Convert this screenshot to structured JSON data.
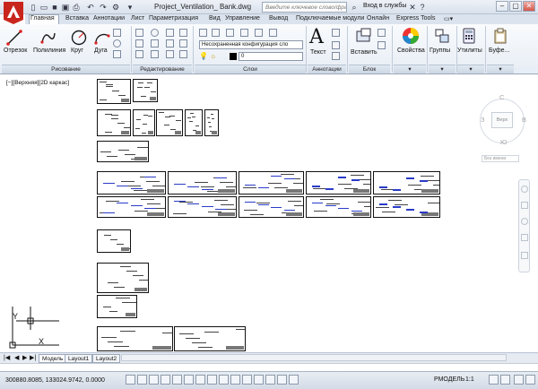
{
  "titlebar": {
    "file_title": "Project_Ventilation_ Bank.dwg",
    "search_placeholder": "Введите ключевое слово/фразу",
    "login": "Вход в службы",
    "help": "?"
  },
  "tabs": [
    "Главная",
    "Вставка",
    "Аннотации",
    "Лист",
    "Параметризация",
    "Вид",
    "Управление",
    "Вывод",
    "Подключаемые модули",
    "Онлайн",
    "Express Tools"
  ],
  "ribbon": {
    "draw_tools": [
      "Отрезок",
      "Полилиния",
      "Круг",
      "Дуга"
    ],
    "draw_group": "Рисование",
    "modify_group": "Редактирование",
    "layer_combo": "Несохраненная конфигурация сло",
    "layer_value": "0",
    "layers_group": "Слои",
    "text_button": "Текст",
    "annotations_group": "Аннотации",
    "insert_button": "Вставить",
    "block_group": "Блок",
    "properties_button": "Свойства",
    "groups_button": "Группы",
    "utilities_button": "Утилиты",
    "clipboard_button": "Буфе..."
  },
  "viewport": {
    "label": "[−][Верхняя][2D каркас]",
    "viewcube": {
      "north": "С",
      "south": "Ю",
      "west": "З",
      "east": "В",
      "top": "Верх",
      "wcs": "Без имени"
    },
    "ucs": {
      "x": "X",
      "y": "Y"
    }
  },
  "layouts": [
    "Модель",
    "Layout1",
    "Layout2"
  ],
  "status": {
    "coords": "300880.8085, 133024.9742, 0.0000",
    "model": "РМОДЕЛЬ",
    "scale": "1:1"
  }
}
